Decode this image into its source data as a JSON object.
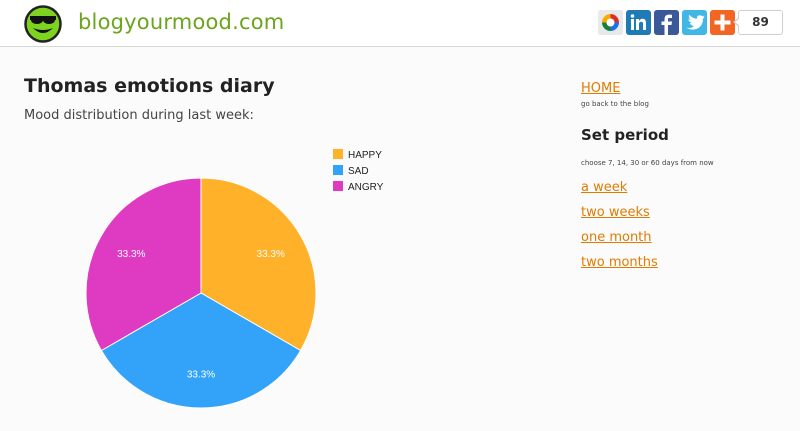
{
  "header": {
    "brand": "blogyourmood.com",
    "share_count": "89",
    "share_buttons": [
      "google-plus-icon",
      "linkedin-icon",
      "facebook-icon",
      "twitter-icon",
      "add-more-icon"
    ]
  },
  "main": {
    "title": "Thomas emotions diary",
    "subtitle": "Mood distribution during last week:"
  },
  "chart_data": {
    "type": "pie",
    "categories": [
      "HAPPY",
      "SAD",
      "ANGRY"
    ],
    "values": [
      33.3,
      33.3,
      33.3
    ],
    "labels": [
      "33.3%",
      "33.3%",
      "33.3%"
    ],
    "colors": [
      "#ffb12a",
      "#33a3f9",
      "#de3bc2"
    ],
    "legend": "top-right",
    "title": ""
  },
  "sidebar": {
    "home_label": "HOME",
    "home_caption": "go back to the blog",
    "period_heading": "Set period",
    "period_caption": "choose 7, 14, 30 or 60 days from now",
    "periods": [
      "a week",
      "two weeks",
      "one month",
      "two months"
    ]
  }
}
